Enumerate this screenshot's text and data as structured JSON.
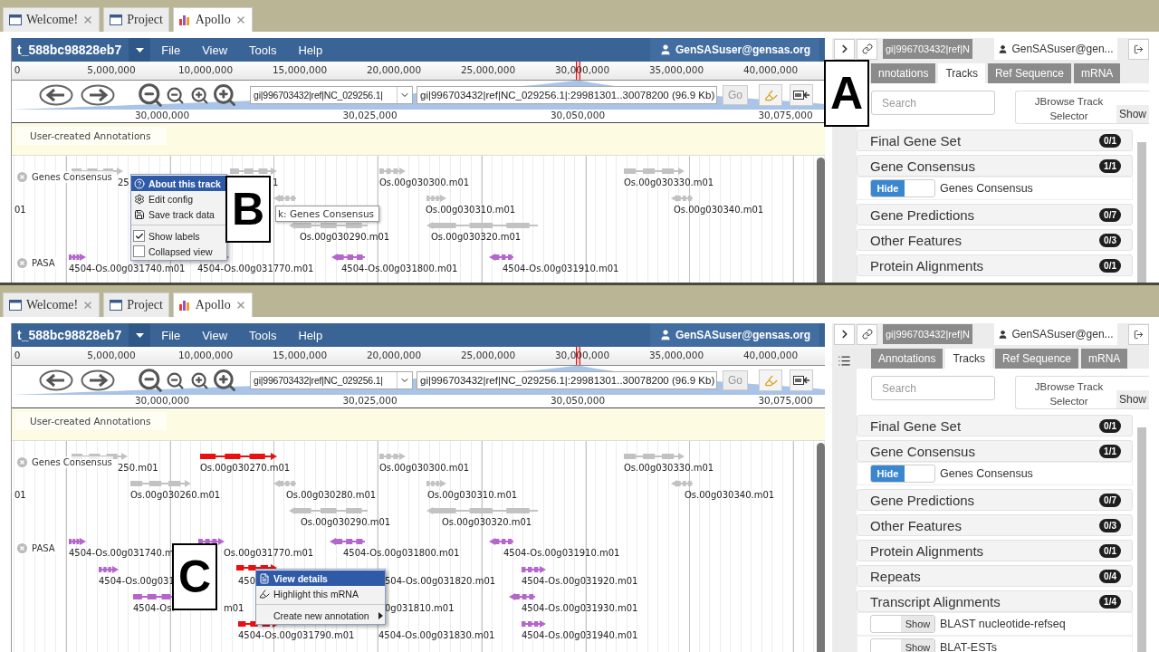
{
  "panels": [
    {
      "browser_tabs": [
        {
          "label": "Welcome!",
          "kind": "page",
          "selected": false,
          "closable": true
        },
        {
          "label": "Project",
          "kind": "page",
          "selected": false,
          "closable": false
        },
        {
          "label": "Apollo",
          "kind": "chart",
          "selected": true,
          "closable": true
        }
      ],
      "app": {
        "title": "t_588bc98828eb7",
        "menus": [
          "File",
          "View",
          "Tools",
          "Help"
        ],
        "user": "GenSASuser@gensas.org",
        "ruler": [
          "0",
          "5,000,000",
          "10,000,000",
          "15,000,000",
          "20,000,000",
          "25,000,000",
          "30,000,000",
          "35,000,000",
          "40,000,000"
        ],
        "sequence": "gi|996703432|ref|NC_029256.1|",
        "location": "gi|996703432|ref|NC_029256.1|:29981301..30078200 (96.9 Kb)",
        "go": "Go",
        "detail_ruler": [
          "30,000,000",
          "30,025,000",
          "30,050,000",
          "30,075,000"
        ],
        "annotation_track": "User-created Annotations",
        "tracks": [
          {
            "label": "Genes Consensus"
          },
          {
            "label": "PASA"
          }
        ],
        "features": [
          {
            "label": "25",
            "kind": "gene",
            "highlighted": false
          },
          {
            "label": "1",
            "kind": "gene",
            "highlighted": false
          },
          {
            "label": "Os.00g030300.m01",
            "kind": "gene",
            "highlighted": false
          },
          {
            "label": "Os.00g030330.m01",
            "kind": "gene",
            "highlighted": false
          },
          {
            "label": "01",
            "kind": "gene"
          },
          {
            "label": "Os.00g030310.m01",
            "kind": "gene",
            "highlighted": false
          },
          {
            "label": "Os.00g030340.m01",
            "kind": "gene",
            "highlighted": false
          },
          {
            "label": "Os.00g030290.m01",
            "kind": "gene",
            "highlighted": false
          },
          {
            "label": "Os.00g030320.m01",
            "kind": "gene",
            "highlighted": false
          },
          {
            "label": "4504-Os.00g031740.m01",
            "kind": "transcript",
            "highlighted": false
          },
          {
            "label": "4504-Os.00g031770.m01",
            "kind": "transcript",
            "highlighted": false
          },
          {
            "label": "4504-Os.00g031800.m01",
            "kind": "transcript",
            "highlighted": false
          },
          {
            "label": "4504-Os.00g031910.m01",
            "kind": "transcript",
            "highlighted": false
          }
        ],
        "context_menu": [
          {
            "label": "About this track",
            "kind": "action",
            "selected": true
          },
          {
            "label": "Edit config",
            "kind": "action",
            "selected": false
          },
          {
            "label": "Save track data",
            "kind": "action",
            "selected": false
          },
          {
            "kind": "separator"
          },
          {
            "label": "Show labels",
            "kind": "check",
            "checked": true
          },
          {
            "label": "Collapsed view",
            "kind": "check",
            "checked": false
          }
        ],
        "tooltip": "k: Genes Consensus"
      },
      "sidebar": {
        "location": "gi|996703432|ref|N",
        "user": "GenSASuser@gen...",
        "tabs": [
          {
            "label": "nnotations",
            "selected": false
          },
          {
            "label": "Tracks",
            "selected": true
          },
          {
            "label": "Ref Sequence",
            "selected": false
          },
          {
            "label": "mRNA",
            "selected": false
          }
        ],
        "search_placeholder": "Search",
        "track_selector": "JBrowse Track Selector",
        "track_selector_button": "Show",
        "groups": [
          {
            "name": "Final Gene Set",
            "count": "0/1"
          },
          {
            "name": "Gene Consensus",
            "count": "1/1",
            "tracks": [
              {
                "label": "Genes Consensus",
                "toggle": "Hide",
                "on": true
              }
            ]
          },
          {
            "name": "Gene Predictions",
            "count": "0/7"
          },
          {
            "name": "Other Features",
            "count": "0/3"
          },
          {
            "name": "Protein Alignments",
            "count": "0/1"
          }
        ]
      },
      "callouts": [
        "A",
        "B"
      ]
    },
    {
      "browser_tabs": [
        {
          "label": "Welcome!",
          "kind": "page",
          "selected": false,
          "closable": true
        },
        {
          "label": "Project",
          "kind": "page",
          "selected": false,
          "closable": false
        },
        {
          "label": "Apollo",
          "kind": "chart",
          "selected": true,
          "closable": true
        }
      ],
      "app": {
        "title": "t_588bc98828eb7",
        "menus": [
          "File",
          "View",
          "Tools",
          "Help"
        ],
        "user": "GenSASuser@gensas.org",
        "ruler": [
          "0",
          "5,000,000",
          "10,000,000",
          "15,000,000",
          "20,000,000",
          "25,000,000",
          "30,000,000",
          "35,000,000",
          "40,000,000"
        ],
        "sequence": "gi|996703432|ref|NC_029256.1|",
        "location": "gi|996703432|ref|NC_029256.1|:29981301..30078200 (96.9 Kb)",
        "go": "Go",
        "detail_ruler": [
          "30,000,000",
          "30,025,000",
          "30,050,000",
          "30,075,000"
        ],
        "annotation_track": "User-created Annotations",
        "tracks": [
          {
            "label": "Genes Consensus"
          },
          {
            "label": "PASA"
          }
        ],
        "features": [
          {
            "label": "250.m01",
            "kind": "gene",
            "highlighted": false
          },
          {
            "label": "Os.00g030270.m01",
            "kind": "gene",
            "highlighted": true
          },
          {
            "label": "Os.00g030300.m01",
            "kind": "gene",
            "highlighted": false
          },
          {
            "label": "Os.00g030330.m01",
            "kind": "gene",
            "highlighted": false
          },
          {
            "label": "01",
            "kind": "gene"
          },
          {
            "label": "Os.00g030260.m01",
            "kind": "gene",
            "highlighted": false
          },
          {
            "label": "Os.00g030280.m01",
            "kind": "gene",
            "highlighted": false
          },
          {
            "label": "Os.00g030310.m01",
            "kind": "gene",
            "highlighted": false
          },
          {
            "label": "Os.00g030340.m01",
            "kind": "gene",
            "highlighted": false
          },
          {
            "label": "Os.00g030290.m01",
            "kind": "gene",
            "highlighted": false
          },
          {
            "label": "Os.00g030320.m01",
            "kind": "gene",
            "highlighted": false
          },
          {
            "label": "4504-Os.00g031740.m",
            "kind": "transcript",
            "highlighted": false
          },
          {
            "label": "Os.00g031770.m01",
            "kind": "transcript",
            "highlighted": false
          },
          {
            "label": "4504-Os.00g031800.m01",
            "kind": "transcript",
            "highlighted": false
          },
          {
            "label": "4504-Os.00g031910.m01",
            "kind": "transcript",
            "highlighted": false
          },
          {
            "label": "4504-Os.00g031",
            "kind": "transcript",
            "highlighted": false
          },
          {
            "label": "450",
            "kind": "transcript",
            "highlighted": true
          },
          {
            "label": "504-Os.00g031820.m01",
            "kind": "transcript"
          },
          {
            "label": "4504-Os.00g031920.m01",
            "kind": "transcript",
            "highlighted": false
          },
          {
            "label": "4504-Os.",
            "kind": "transcript",
            "highlighted": false
          },
          {
            "label": "m01",
            "kind": "transcript"
          },
          {
            "label": "0g031810.m01",
            "kind": "transcript"
          },
          {
            "label": "4504-Os.00g031930.m01",
            "kind": "transcript",
            "highlighted": false
          },
          {
            "label": "4504-Os.00g031790.m01",
            "kind": "transcript",
            "highlighted": true
          },
          {
            "label": "4504-Os.00g031830.m01",
            "kind": "transcript"
          },
          {
            "label": "4504-Os.00g031940.m01",
            "kind": "transcript",
            "highlighted": false
          }
        ],
        "context_menu": [
          {
            "label": "View details",
            "kind": "action",
            "selected": true
          },
          {
            "label": "Highlight this mRNA",
            "kind": "action",
            "selected": false
          },
          {
            "kind": "separator"
          },
          {
            "label": "Create new annotation",
            "kind": "submenu",
            "selected": false
          }
        ]
      },
      "sidebar": {
        "location": "gi|996703432|ref|N",
        "user": "GenSASuser@gen...",
        "list_button": true,
        "tabs": [
          {
            "label": "Annotations",
            "selected": false
          },
          {
            "label": "Tracks",
            "selected": true
          },
          {
            "label": "Ref Sequence",
            "selected": false
          },
          {
            "label": "mRNA",
            "selected": false
          }
        ],
        "search_placeholder": "Search",
        "track_selector": "JBrowse Track Selector",
        "track_selector_button": "Show",
        "groups": [
          {
            "name": "Final Gene Set",
            "count": "0/1"
          },
          {
            "name": "Gene Consensus",
            "count": "1/1",
            "tracks": [
              {
                "label": "Genes Consensus",
                "toggle": "Hide",
                "on": true
              }
            ]
          },
          {
            "name": "Gene Predictions",
            "count": "0/7"
          },
          {
            "name": "Other Features",
            "count": "0/3"
          },
          {
            "name": "Protein Alignments",
            "count": "0/1"
          },
          {
            "name": "Repeats",
            "count": "0/4"
          },
          {
            "name": "Transcript Alignments",
            "count": "1/4",
            "tracks": [
              {
                "label": "BLAST nucleotide-refseq",
                "toggle": "Show",
                "on": false
              },
              {
                "label": "BLAT-ESTs",
                "toggle": "Show",
                "on": false
              }
            ]
          }
        ]
      },
      "callouts": [
        "C"
      ]
    }
  ]
}
